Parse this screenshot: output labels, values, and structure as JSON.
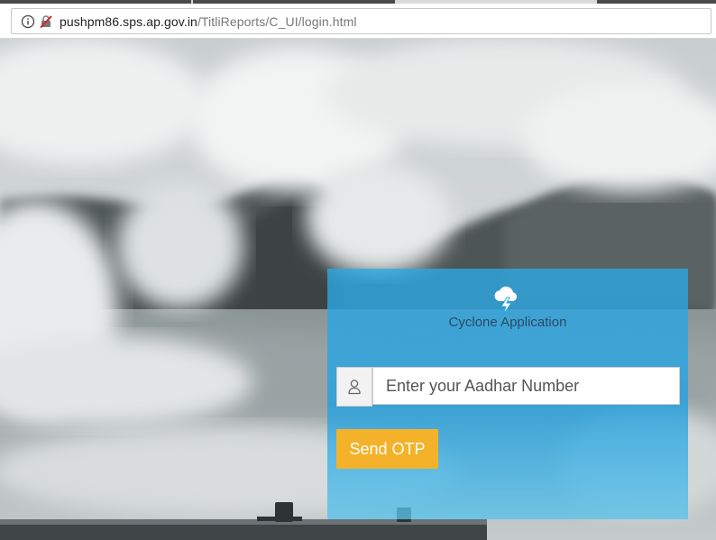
{
  "browser": {
    "url_host": "pushpm86.sps.ap.gov.in",
    "url_path": "/TitliReports/C_UI/login.html",
    "info_icon": "info-icon",
    "security_icon": "not-secure-icon"
  },
  "page": {
    "background": "cyclone-waves-photo"
  },
  "login": {
    "logo_icon": "cloud-lightning-icon",
    "app_title": "Cyclone Application",
    "aadhar_placeholder": "Enter your Aadhar Number",
    "aadhar_value": "",
    "user_icon": "user-icon",
    "send_otp_label": "Send OTP"
  },
  "colors": {
    "panel": "#2aa8e4",
    "button": "#f4b22a",
    "title_text": "#2a4a66"
  }
}
